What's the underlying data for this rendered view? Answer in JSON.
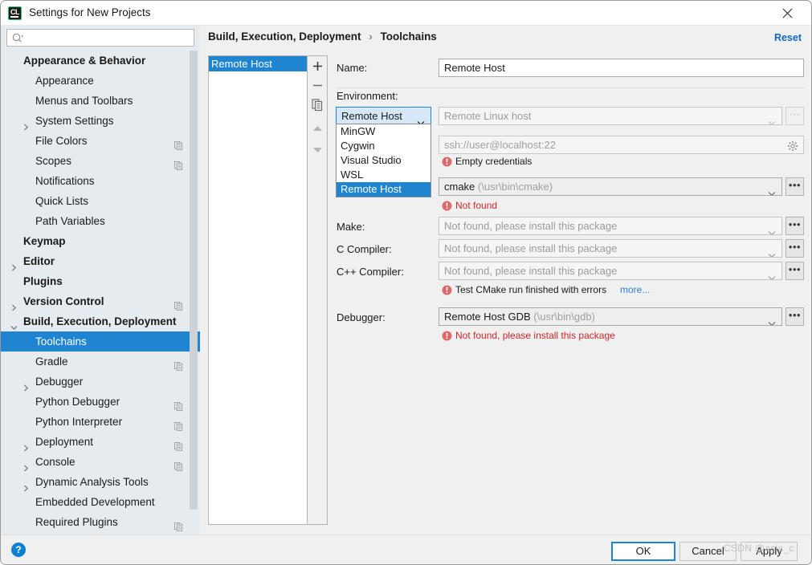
{
  "window": {
    "title": "Settings for New Projects",
    "app_icon": "clion-icon",
    "close_icon": "close-icon"
  },
  "search": {
    "placeholder": "",
    "value": "",
    "icon": "search-icon"
  },
  "sidebar": {
    "items": [
      {
        "label": "Appearance & Behavior",
        "indent": 28,
        "bold": true,
        "arrow": "",
        "copy": false,
        "selected": false
      },
      {
        "label": "Appearance",
        "indent": 43,
        "bold": false,
        "arrow": "",
        "copy": false,
        "selected": false
      },
      {
        "label": "Menus and Toolbars",
        "indent": 43,
        "bold": false,
        "arrow": "",
        "copy": false,
        "selected": false
      },
      {
        "label": "System Settings",
        "indent": 43,
        "bold": false,
        "arrow": "right",
        "copy": false,
        "selected": false
      },
      {
        "label": "File Colors",
        "indent": 43,
        "bold": false,
        "arrow": "",
        "copy": true,
        "selected": false
      },
      {
        "label": "Scopes",
        "indent": 43,
        "bold": false,
        "arrow": "",
        "copy": true,
        "selected": false
      },
      {
        "label": "Notifications",
        "indent": 43,
        "bold": false,
        "arrow": "",
        "copy": false,
        "selected": false
      },
      {
        "label": "Quick Lists",
        "indent": 43,
        "bold": false,
        "arrow": "",
        "copy": false,
        "selected": false
      },
      {
        "label": "Path Variables",
        "indent": 43,
        "bold": false,
        "arrow": "",
        "copy": false,
        "selected": false
      },
      {
        "label": "Keymap",
        "indent": 28,
        "bold": true,
        "arrow": "",
        "copy": false,
        "selected": false
      },
      {
        "label": "Editor",
        "indent": 28,
        "bold": true,
        "arrow": "right",
        "copy": false,
        "selected": false
      },
      {
        "label": "Plugins",
        "indent": 28,
        "bold": true,
        "arrow": "",
        "copy": false,
        "selected": false
      },
      {
        "label": "Version Control",
        "indent": 28,
        "bold": true,
        "arrow": "right",
        "copy": true,
        "selected": false
      },
      {
        "label": "Build, Execution, Deployment",
        "indent": 28,
        "bold": true,
        "arrow": "down",
        "copy": false,
        "selected": false
      },
      {
        "label": "Toolchains",
        "indent": 43,
        "bold": false,
        "arrow": "",
        "copy": false,
        "selected": true
      },
      {
        "label": "Gradle",
        "indent": 43,
        "bold": false,
        "arrow": "",
        "copy": true,
        "selected": false
      },
      {
        "label": "Debugger",
        "indent": 43,
        "bold": false,
        "arrow": "right",
        "copy": false,
        "selected": false
      },
      {
        "label": "Python Debugger",
        "indent": 43,
        "bold": false,
        "arrow": "",
        "copy": true,
        "selected": false
      },
      {
        "label": "Python Interpreter",
        "indent": 43,
        "bold": false,
        "arrow": "",
        "copy": true,
        "selected": false
      },
      {
        "label": "Deployment",
        "indent": 43,
        "bold": false,
        "arrow": "right",
        "copy": true,
        "selected": false
      },
      {
        "label": "Console",
        "indent": 43,
        "bold": false,
        "arrow": "right",
        "copy": true,
        "selected": false
      },
      {
        "label": "Dynamic Analysis Tools",
        "indent": 43,
        "bold": false,
        "arrow": "right",
        "copy": false,
        "selected": false
      },
      {
        "label": "Embedded Development",
        "indent": 43,
        "bold": false,
        "arrow": "",
        "copy": false,
        "selected": false
      },
      {
        "label": "Required Plugins",
        "indent": 43,
        "bold": false,
        "arrow": "",
        "copy": true,
        "selected": false
      }
    ]
  },
  "breadcrumb": {
    "root": "Build, Execution, Deployment",
    "separator": "›",
    "leaf": "Toolchains"
  },
  "reset": {
    "label": "Reset"
  },
  "toolchain_list": {
    "items": [
      {
        "label": "Remote Host",
        "selected": true
      }
    ]
  },
  "list_toolbar": {
    "add": "plus-icon",
    "remove": "minus-icon",
    "copy": "copy-icon",
    "move_up": "arrow-up-icon",
    "move_down": "arrow-down-icon"
  },
  "form": {
    "name_label": "Name:",
    "name_value": "Remote Host",
    "environment_label": "Environment:",
    "environment_value": "Remote Host",
    "environment_options": [
      "MinGW",
      "Cygwin",
      "Visual Studio",
      "WSL",
      "Remote Host"
    ],
    "environment_selected_option": "Remote Host",
    "credentials_value": "Remote Linux host",
    "credentials_browse": "...",
    "ssh_placeholder": "ssh://user@localhost:22",
    "ssh_gear_icon": "gear-icon",
    "error_empty_credentials": "Empty credentials",
    "cmake_value": "cmake",
    "cmake_path": "(\\usr\\bin\\cmake)",
    "cmake_browse": "...",
    "error_cmake_not_found": "Not found",
    "make_label": "Make:",
    "make_value": "Not found, please install this package",
    "c_compiler_label": "C Compiler:",
    "c_compiler_value": "Not found, please install this package",
    "cpp_compiler_label": "C++ Compiler:",
    "cpp_compiler_value": "Not found, please install this package",
    "error_test_cmake": "Test CMake run finished with errors",
    "error_test_cmake_link": "more...",
    "debugger_label": "Debugger:",
    "debugger_value": "Remote Host GDB",
    "debugger_path": "(\\usr\\bin\\gdb)",
    "error_debugger_not_found": "Not found, please install this package",
    "browse_dots": "•••",
    "browse_dots_disabled": "⋯"
  },
  "footer": {
    "help_icon": "help-icon",
    "help_glyph": "?",
    "ok": "OK",
    "cancel": "Cancel",
    "apply": "Apply"
  },
  "watermark": {
    "text": "CSDN @asia_c"
  },
  "colors": {
    "accent": "#1f85d0",
    "error": "#dd6a6a",
    "error_text": "#cc2828",
    "link": "#1267c4",
    "sidebar_bg": "#e6ebef",
    "panel_bg": "#f0f0f0"
  }
}
